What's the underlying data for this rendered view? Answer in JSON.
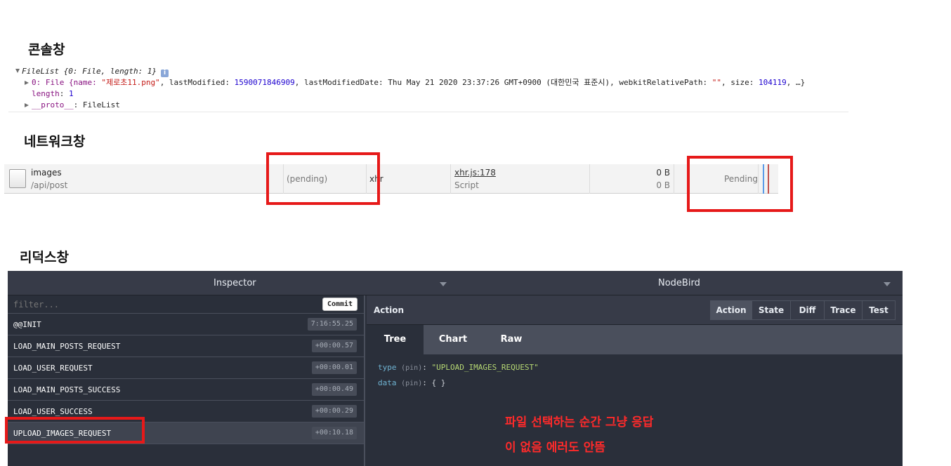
{
  "headings": {
    "console": "콘솔창",
    "network": "네트워크창",
    "redux": "리덕스창"
  },
  "console": {
    "line1": "FileList {0: File, length: 1}",
    "line1_info": "i",
    "line2_prefix": "0: File {name: ",
    "line2_name": "\"제로초11.png\"",
    "line2_mid": ", lastModified: ",
    "line2_lastModified": "1590071846909",
    "line2_rest": ", lastModifiedDate: Thu May 21 2020 23:37:26 GMT+0900 (대한민국 표준시), webkitRelativePath: ",
    "line2_path": "\"\"",
    "line2_size_label": ", size: ",
    "line2_size": "104119",
    "line2_end": ", …}",
    "line3_key": "length",
    "line3_value": "1",
    "line4_key": "__proto__",
    "line4_value": ": FileList"
  },
  "network": {
    "name": "images",
    "path": "/api/post",
    "status": "(pending)",
    "type": "xhr",
    "initiator": "xhr.js:178",
    "initiator_type": "Script",
    "size": "0 B",
    "content_size": "0 B",
    "time": "Pending"
  },
  "redux": {
    "inspector_label": "Inspector",
    "instance_label": "NodeBird",
    "filter_placeholder": "filter...",
    "commit_label": "Commit",
    "actions": [
      {
        "name": "@@INIT",
        "time": "7:16:55.25"
      },
      {
        "name": "LOAD_MAIN_POSTS_REQUEST",
        "time": "+00:00.57"
      },
      {
        "name": "LOAD_USER_REQUEST",
        "time": "+00:00.01"
      },
      {
        "name": "LOAD_MAIN_POSTS_SUCCESS",
        "time": "+00:00.49"
      },
      {
        "name": "LOAD_USER_SUCCESS",
        "time": "+00:00.29"
      },
      {
        "name": "UPLOAD_IMAGES_REQUEST",
        "time": "+00:10.18"
      }
    ],
    "panel_title": "Action",
    "modes": [
      "Action",
      "State",
      "Diff",
      "Trace",
      "Test"
    ],
    "subtabs": [
      "Tree",
      "Chart",
      "Raw"
    ],
    "tree": {
      "type_key": "type",
      "type_pin": "(pin)",
      "type_value": "\"UPLOAD_IMAGES_REQUEST\"",
      "data_key": "data",
      "data_pin": "(pin)",
      "data_value": "{ }"
    }
  },
  "annotation": {
    "line1": "파일 선택하는 순간 그냥 응답",
    "line2": "이 없음 에러도 안뜸"
  },
  "colors": {
    "highlight_red": "#e61919",
    "redux_bg": "#2a2f3a"
  }
}
